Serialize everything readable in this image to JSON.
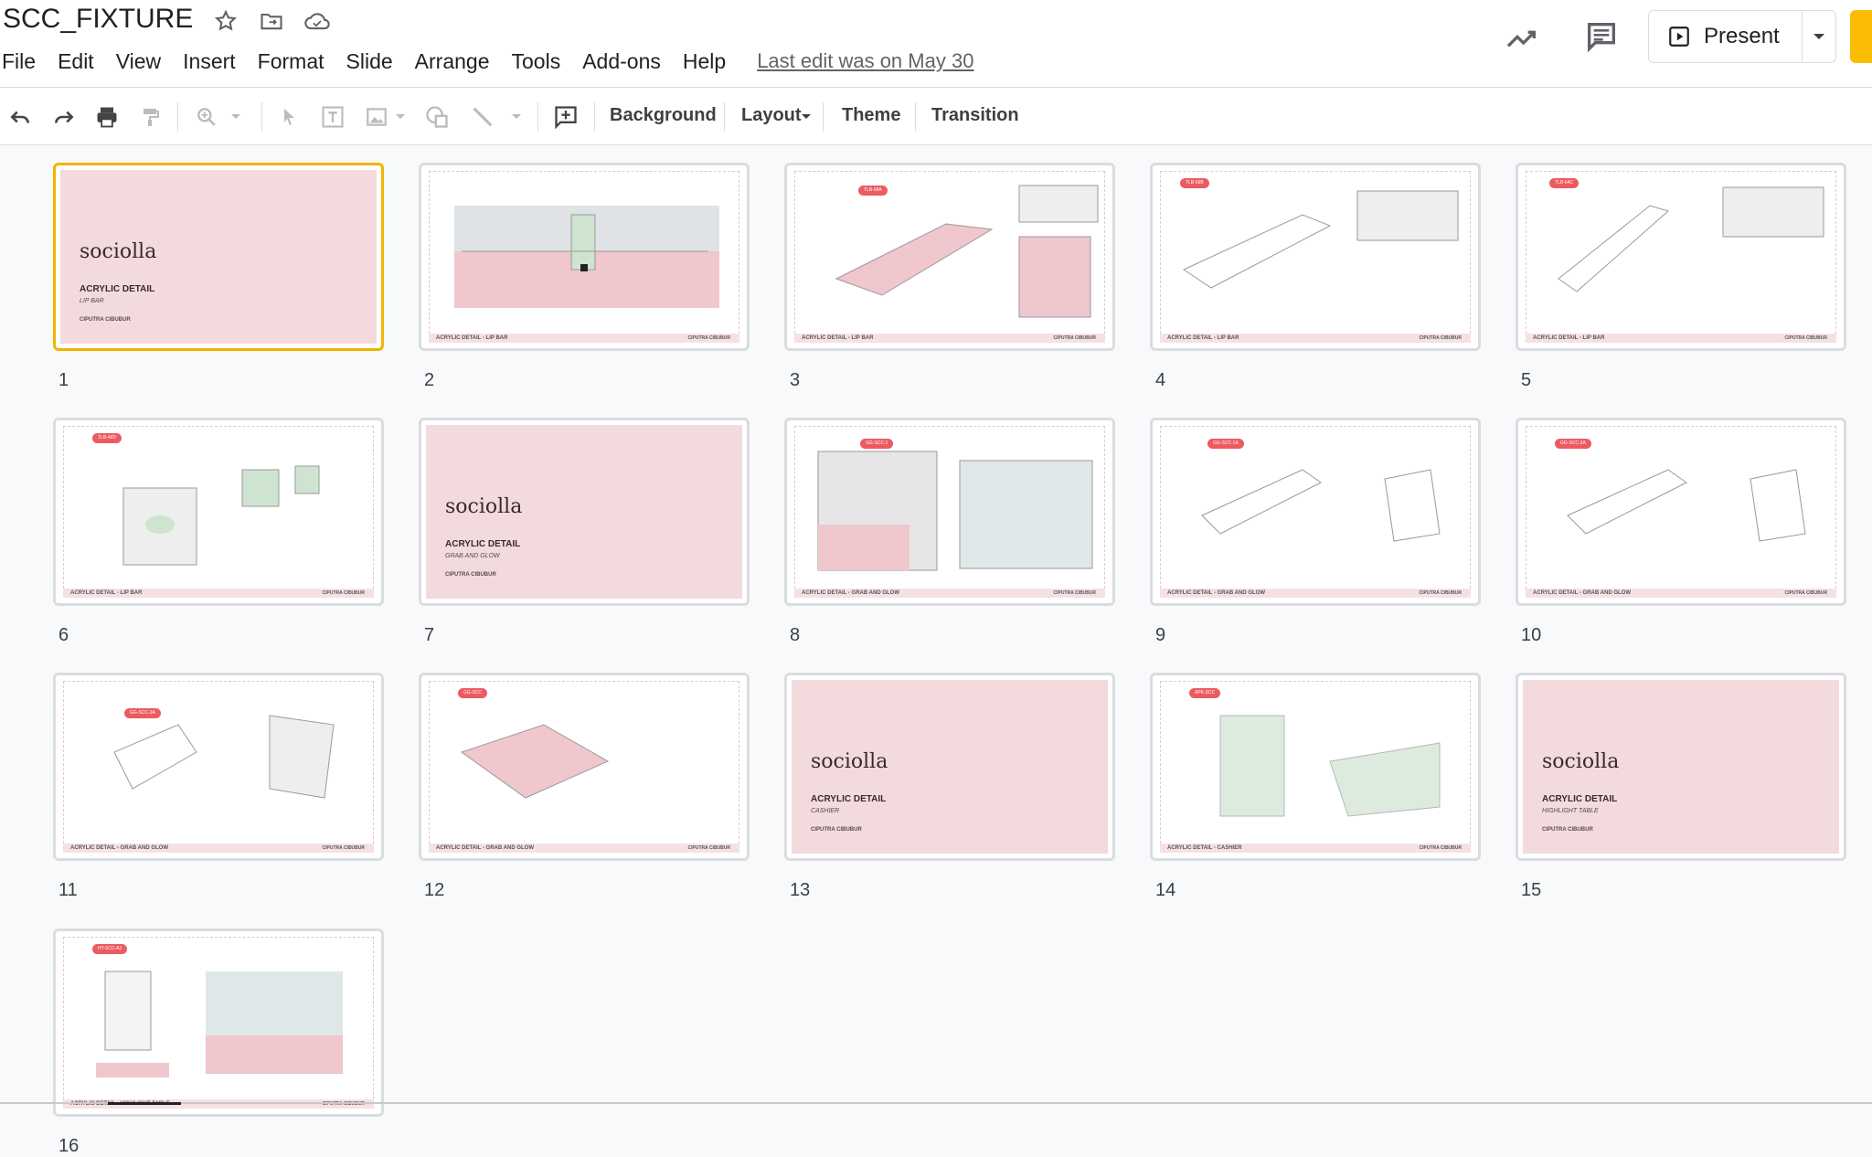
{
  "doc": {
    "title": "SCC_FIXTURE"
  },
  "menu": [
    {
      "label": "File"
    },
    {
      "label": "Edit"
    },
    {
      "label": "View"
    },
    {
      "label": "Insert"
    },
    {
      "label": "Format"
    },
    {
      "label": "Slide"
    },
    {
      "label": "Arrange"
    },
    {
      "label": "Tools"
    },
    {
      "label": "Add-ons"
    },
    {
      "label": "Help"
    }
  ],
  "last_edit": "Last edit was on May 30",
  "present": {
    "label": "Present"
  },
  "toolbar": {
    "background": "Background",
    "layout": "Layout",
    "theme": "Theme",
    "transition": "Transition"
  },
  "colors": {
    "selected_border": "#f2b400",
    "cover_pink": "#f2dadd",
    "tag_red": "#ec5b60",
    "share_yellow": "#fbbc04"
  },
  "slides": [
    {
      "num": "1",
      "type": "cover",
      "logo": "sociolla",
      "title": "ACRYLIC DETAIL",
      "subtitle": "LIP BAR",
      "place": "CIPUTRA CIBUBUR"
    },
    {
      "num": "2",
      "type": "drawing",
      "footer": "ACRYLIC DETAIL - LIP BAR",
      "place": "CIPUTRA CIBUBUR"
    },
    {
      "num": "3",
      "type": "drawing",
      "tag": "TLB-68A",
      "footer": "ACRYLIC DETAIL - LIP BAR",
      "place": "CIPUTRA CIBUBUR"
    },
    {
      "num": "4",
      "type": "drawing",
      "tag": "TLB-69B",
      "footer": "ACRYLIC DETAIL - LIP BAR",
      "place": "CIPUTRA CIBUBUR"
    },
    {
      "num": "5",
      "type": "drawing",
      "tag": "TLB-64C",
      "footer": "ACRYLIC DETAIL - LIP BAR",
      "place": "CIPUTRA CIBUBUR"
    },
    {
      "num": "6",
      "type": "drawing",
      "tag": "TLB-46D",
      "footer": "ACRYLIC DETAIL - LIP BAR",
      "place": "CIPUTRA CIBUBUR"
    },
    {
      "num": "7",
      "type": "cover",
      "logo": "sociolla",
      "title": "ACRYLIC DETAIL",
      "subtitle": "GRAB AND GLOW",
      "place": "CIPUTRA CIBUBUR"
    },
    {
      "num": "8",
      "type": "drawing",
      "tag": "GG-SCC-1",
      "footer": "ACRYLIC DETAIL - GRAB AND GLOW",
      "place": "CIPUTRA CIBUBUR"
    },
    {
      "num": "9",
      "type": "drawing",
      "tag": "GG-SCC-1A",
      "footer": "ACRYLIC DETAIL - GRAB AND GLOW",
      "place": "CIPUTRA CIBUBUR"
    },
    {
      "num": "10",
      "type": "drawing",
      "tag": "GG-SCC-2A",
      "footer": "ACRYLIC DETAIL - GRAB AND GLOW",
      "place": "CIPUTRA CIBUBUR"
    },
    {
      "num": "11",
      "type": "drawing",
      "tag": "GG-SCC-3A",
      "footer": "ACRYLIC DETAIL - GRAB AND GLOW",
      "place": "CIPUTRA CIBUBUR"
    },
    {
      "num": "12",
      "type": "drawing",
      "tag": "GG-SCC",
      "footer": "ACRYLIC DETAIL - GRAB AND GLOW",
      "place": "CIPUTRA CIBUBUR"
    },
    {
      "num": "13",
      "type": "cover",
      "logo": "sociolla",
      "title": "ACRYLIC DETAIL",
      "subtitle": "CASHIER",
      "place": "CIPUTRA CIBUBUR"
    },
    {
      "num": "14",
      "type": "drawing",
      "tag": "APK-SCC",
      "footer": "ACRYLIC DETAIL - CASHIER",
      "place": "CIPUTRA CIBUBUR"
    },
    {
      "num": "15",
      "type": "cover",
      "logo": "sociolla",
      "title": "ACRYLIC DETAIL",
      "subtitle": "HIGHLIGHT TABLE",
      "place": "CIPUTRA CIBUBUR"
    },
    {
      "num": "16",
      "type": "drawing",
      "tag": "HT-SCC-A1",
      "footer": "ACRYLIC DETAIL - HIGHLIGHT TABLE",
      "place": "CIPUTRA CIBUBUR"
    }
  ]
}
